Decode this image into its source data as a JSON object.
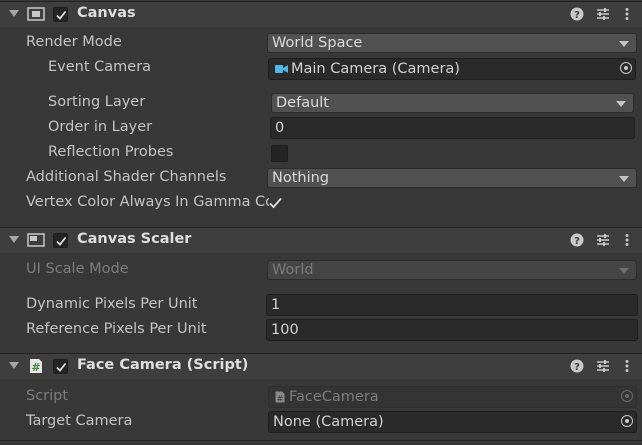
{
  "canvas": {
    "title": "Canvas",
    "enabled": true,
    "render_mode_label": "Render Mode",
    "render_mode_value": "World Space",
    "event_camera_label": "Event Camera",
    "event_camera_value": "Main Camera (Camera)",
    "sorting_layer_label": "Sorting Layer",
    "sorting_layer_value": "Default",
    "order_in_layer_label": "Order in Layer",
    "order_in_layer_value": "0",
    "reflection_probes_label": "Reflection Probes",
    "additional_shader_channels_label": "Additional Shader Channels",
    "additional_shader_channels_value": "Nothing",
    "vertex_color_label": "Vertex Color Always In Gamma Co",
    "vertex_color_checked": true
  },
  "canvas_scaler": {
    "title": "Canvas Scaler",
    "enabled": true,
    "ui_scale_mode_label": "UI Scale Mode",
    "ui_scale_mode_value": "World",
    "dynamic_pixels_label": "Dynamic Pixels Per Unit",
    "dynamic_pixels_value": "1",
    "reference_pixels_label": "Reference Pixels Per Unit",
    "reference_pixels_value": "100"
  },
  "face_camera": {
    "title": "Face Camera (Script)",
    "enabled": true,
    "script_label": "Script",
    "script_value": "FaceCamera",
    "target_camera_label": "Target Camera",
    "target_camera_value": "None (Camera)"
  },
  "icons": {
    "help": "help-icon",
    "presets": "presets-icon",
    "menu": "kebab-menu-icon",
    "camera": "camera-icon",
    "script": "script-icon"
  },
  "colors": {
    "background": "#383838",
    "header": "#3e3e3e",
    "camera_icon": "#4fb7e6",
    "script_icon": "#6cb86c"
  }
}
